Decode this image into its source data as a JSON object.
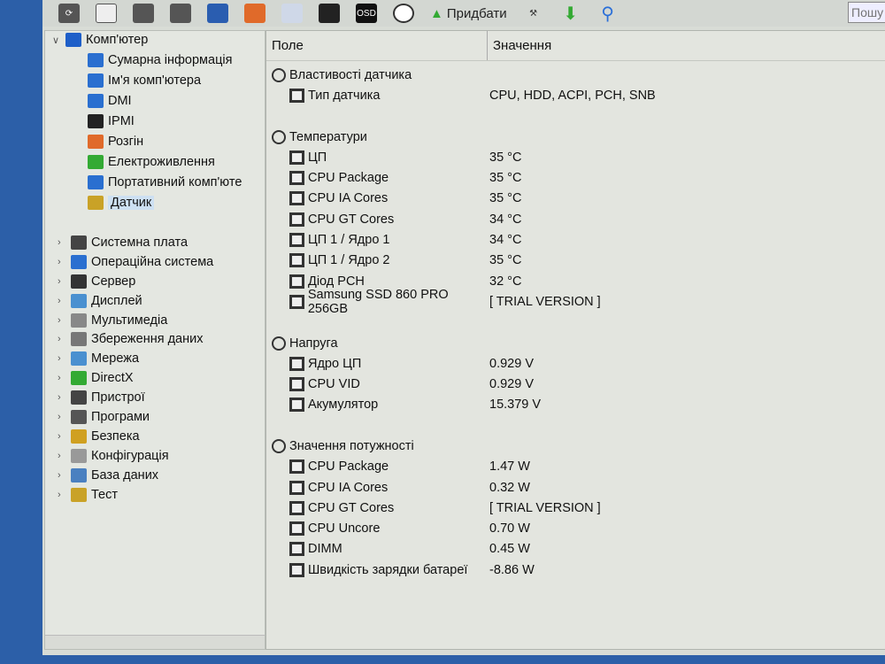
{
  "toolbar": {
    "buy_label": "Придбати",
    "search_placeholder": "Пошу",
    "osd_label": "OSD"
  },
  "tree": {
    "root": "Комп'ютер",
    "children": [
      "Сумарна інформація",
      "Ім'я комп'ютера",
      "DMI",
      "IPMI",
      "Розгін",
      "Електроживлення",
      "Портативний комп'юте",
      "Датчик"
    ],
    "selected": "Датчик",
    "top": [
      "Системна плата",
      "Операційна система",
      "Сервер",
      "Дисплей",
      "Мультимедіа",
      "Збереження даних",
      "Мережа",
      "DirectX",
      "Пристрої",
      "Програми",
      "Безпека",
      "Конфігурація",
      "База даних",
      "Тест"
    ]
  },
  "columns": {
    "field": "Поле",
    "value": "Значення"
  },
  "groups": [
    {
      "title": "Властивості датчика",
      "icon": "sensor-icon",
      "items": [
        {
          "f": "Тип датчика",
          "v": "CPU, HDD, ACPI, PCH, SNB"
        }
      ]
    },
    {
      "title": "Температури",
      "icon": "thermometer-icon",
      "items": [
        {
          "f": "ЦП",
          "v": "35 °C"
        },
        {
          "f": "CPU Package",
          "v": "35 °C"
        },
        {
          "f": "CPU IA Cores",
          "v": "35 °C"
        },
        {
          "f": "CPU GT Cores",
          "v": "34 °C"
        },
        {
          "f": "ЦП 1 / Ядро 1",
          "v": "34 °C"
        },
        {
          "f": "ЦП 1 / Ядро 2",
          "v": "35 °C"
        },
        {
          "f": "Діод PCH",
          "v": "32 °C"
        },
        {
          "f": "Samsung SSD 860 PRO 256GB",
          "v": "[ TRIAL VERSION ]"
        }
      ]
    },
    {
      "title": "Напруга",
      "icon": "voltage-icon",
      "items": [
        {
          "f": "Ядро ЦП",
          "v": "0.929 V"
        },
        {
          "f": "CPU VID",
          "v": "0.929 V"
        },
        {
          "f": "Акумулятор",
          "v": "15.379 V"
        }
      ]
    },
    {
      "title": "Значення потужності",
      "icon": "power-icon",
      "items": [
        {
          "f": "CPU Package",
          "v": "1.47 W"
        },
        {
          "f": "CPU IA Cores",
          "v": "0.32 W"
        },
        {
          "f": "CPU GT Cores",
          "v": "[ TRIAL VERSION ]"
        },
        {
          "f": "CPU Uncore",
          "v": "0.70 W"
        },
        {
          "f": "DIMM",
          "v": "0.45 W"
        },
        {
          "f": "Швидкість зарядки батареї",
          "v": "-8.86 W"
        }
      ]
    }
  ]
}
